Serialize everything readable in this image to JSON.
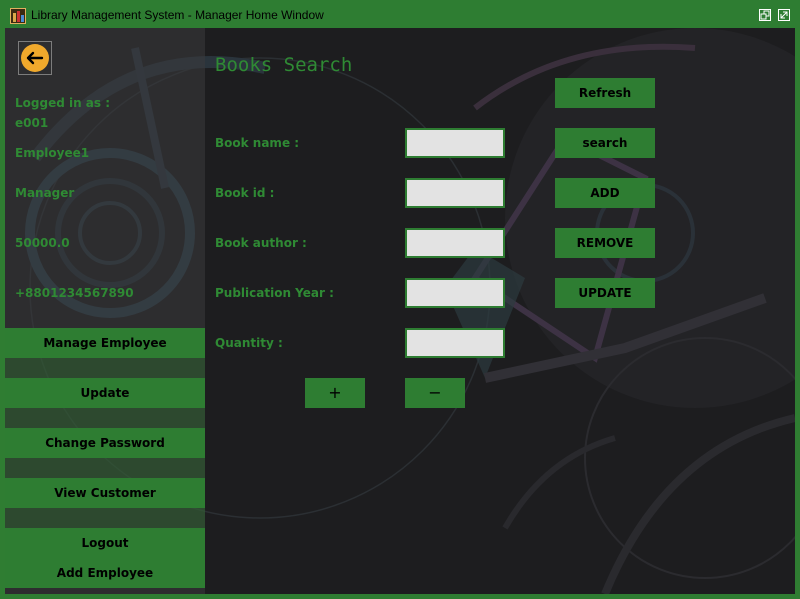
{
  "window": {
    "title": "Library Management System - Manager Home Window"
  },
  "colors": {
    "accent": "#2e7d32",
    "text_green": "#2f8a34",
    "background": "#1d1d1f",
    "field_bg": "#e3e3e3",
    "back_icon": "#f0a92c"
  },
  "icons": {
    "app": "books-icon",
    "back": "arrow-left-icon",
    "restore": "restore-icon",
    "maximize": "maximize-icon"
  },
  "user": {
    "logged_in_label": "Logged in as :",
    "id": "e001",
    "name": "Employee1",
    "role": "Manager",
    "salary": "50000.0",
    "phone": "+8801234567890"
  },
  "sidebar": {
    "manage_employee": "Manage Employee",
    "update": "Update",
    "change_password": "Change Password",
    "view_customer": "View Customer",
    "logout": "Logout",
    "add_employee": "Add Employee"
  },
  "main": {
    "title": "Books Search",
    "fields": {
      "book_name": {
        "label": "Book name :",
        "value": ""
      },
      "book_id": {
        "label": "Book id :",
        "value": ""
      },
      "book_author": {
        "label": "Book author :",
        "value": ""
      },
      "publication_year": {
        "label": "Publication Year :",
        "value": ""
      },
      "quantity": {
        "label": "Quantity :",
        "value": ""
      }
    },
    "buttons": {
      "refresh": "Refresh",
      "search": "search",
      "add": "ADD",
      "remove": "REMOVE",
      "update": "UPDATE",
      "plus": "+",
      "minus": "−"
    }
  }
}
